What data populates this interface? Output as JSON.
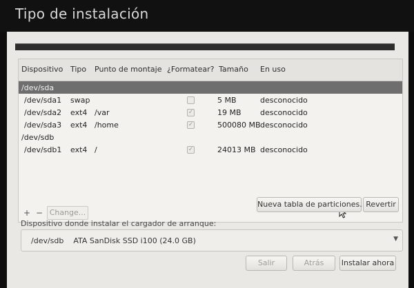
{
  "window": {
    "title": "Tipo de instalación"
  },
  "table": {
    "columns": [
      "Dispositivo",
      "Tipo",
      "Punto de montaje",
      "¿Formatear?",
      "Tamaño",
      "En uso"
    ],
    "rows": [
      {
        "device": "/dev/sda",
        "type": "",
        "mount": "",
        "format": null,
        "size": "",
        "in_use": "",
        "selected": true
      },
      {
        "device": "/dev/sda1",
        "type": "swap",
        "mount": "",
        "format": false,
        "size": "5 MB",
        "in_use": "desconocido"
      },
      {
        "device": "/dev/sda2",
        "type": "ext4",
        "mount": "/var",
        "format": true,
        "size": "19 MB",
        "in_use": "desconocido"
      },
      {
        "device": "/dev/sda3",
        "type": "ext4",
        "mount": "/home",
        "format": true,
        "size": "500080 MB",
        "in_use": "desconocido"
      },
      {
        "device": "/dev/sdb",
        "type": "",
        "mount": "",
        "format": null,
        "size": "",
        "in_use": ""
      },
      {
        "device": "/dev/sdb1",
        "type": "ext4",
        "mount": "/",
        "format": true,
        "size": "24013 MB",
        "in_use": "desconocido"
      }
    ]
  },
  "toolbar": {
    "add_label": "+",
    "remove_label": "−",
    "change_label": "Change...",
    "new_table_label": "Nueva tabla de particiones...",
    "revert_label": "Revertir"
  },
  "bootloader": {
    "label": "Dispositivo donde instalar el cargador de arranque:",
    "device": "/dev/sdb",
    "model": "ATA SanDisk SSD i100 (24.0 GB)"
  },
  "footer": {
    "quit_label": "Salir",
    "back_label": "Atrás",
    "install_label": "Instalar ahora"
  },
  "icons": {
    "checkbox": "check-icon",
    "dropdown": "chevron-down-icon",
    "cursor": "mouse-pointer-icon"
  },
  "colors": {
    "background": "#0d0d0d",
    "panel": "#e9e8e4",
    "selected_row": "#6e6e6e"
  }
}
